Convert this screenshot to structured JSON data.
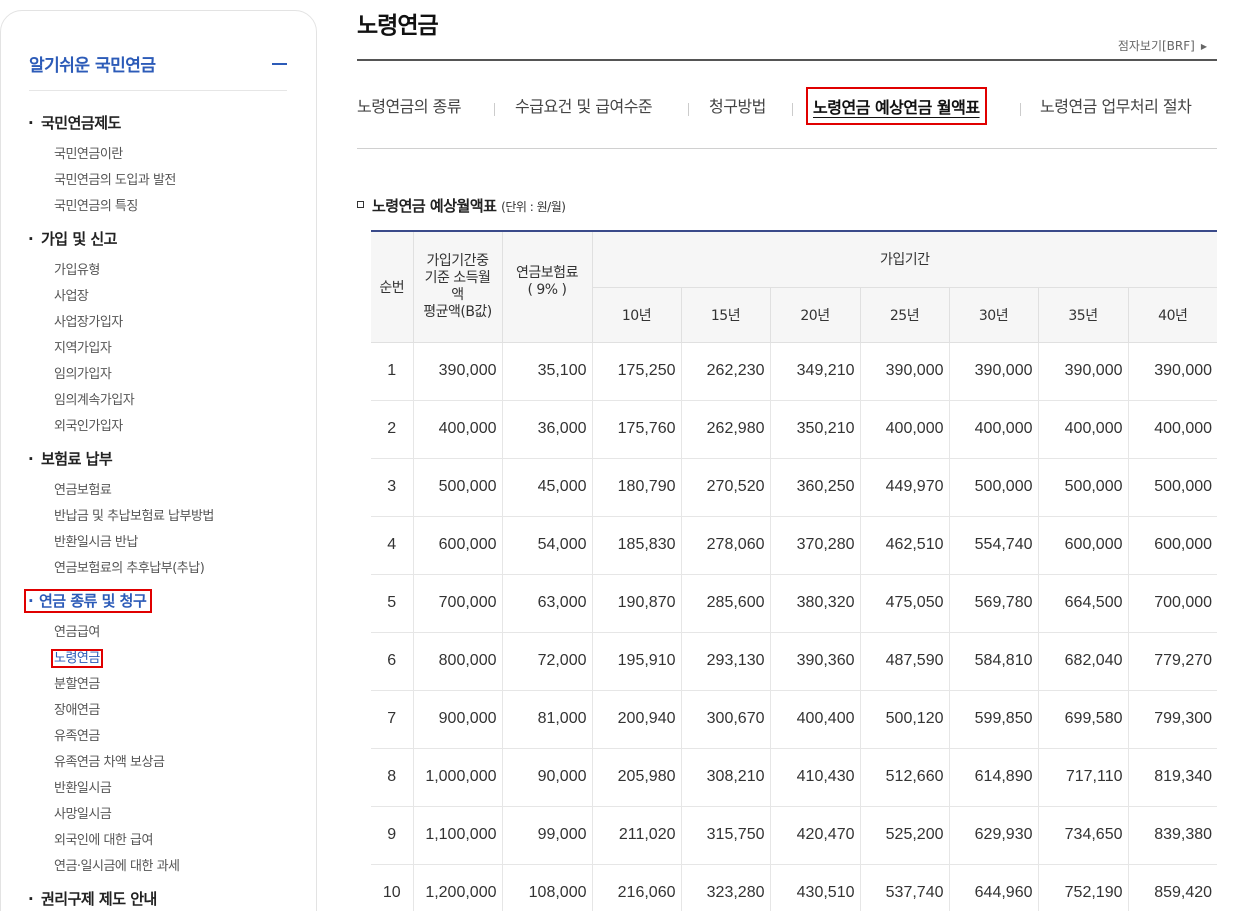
{
  "sidebar": {
    "title": "알기쉬운 국민연금",
    "sections": [
      {
        "label": "국민연금제도",
        "items": [
          "국민연금이란",
          "국민연금의 도입과 발전",
          "국민연금의 특징"
        ]
      },
      {
        "label": "가입 및 신고",
        "items": [
          "가입유형",
          "사업장",
          "사업장가입자",
          "지역가입자",
          "임의가입자",
          "임의계속가입자",
          "외국인가입자"
        ]
      },
      {
        "label": "보험료 납부",
        "items": [
          "연금보험료",
          "반납금 및 추납보험료 납부방법",
          "반환일시금 반납",
          "연금보험료의 추후납부(추납)"
        ]
      },
      {
        "label": "연금 종류 및 청구",
        "items": [
          "연금급여",
          "노령연금",
          "분할연금",
          "장애연금",
          "유족연금",
          "유족연금 차액 보상금",
          "반환일시금",
          "사망일시금",
          "외국인에 대한 급여",
          "연금·일시금에 대한 과세"
        ]
      },
      {
        "label": "권리구제 제도 안내",
        "items": []
      }
    ]
  },
  "main": {
    "title": "노령연금",
    "braille_link": "점자보기[BRF]",
    "tabs": [
      "노령연금의 종류",
      "수급요건 및 급여수준",
      "청구방법",
      "노령연금 예상연금 월액표",
      "노령연금 업무처리 절차"
    ],
    "table_title": "노령연금 예상월액표",
    "table_unit": "(단위 : 원/월)",
    "headers": {
      "no": "순번",
      "income_lines": [
        "가입기간중",
        "기준 소득월",
        "액",
        "평균액(B값)"
      ],
      "premium_lines": [
        "연금보험료",
        "( 9% )"
      ],
      "period": "가입기간",
      "years": [
        "10년",
        "15년",
        "20년",
        "25년",
        "30년",
        "35년",
        "40년"
      ]
    },
    "rows": [
      [
        "1",
        "390,000",
        "35,100",
        "175,250",
        "262,230",
        "349,210",
        "390,000",
        "390,000",
        "390,000",
        "390,000"
      ],
      [
        "2",
        "400,000",
        "36,000",
        "175,760",
        "262,980",
        "350,210",
        "400,000",
        "400,000",
        "400,000",
        "400,000"
      ],
      [
        "3",
        "500,000",
        "45,000",
        "180,790",
        "270,520",
        "360,250",
        "449,970",
        "500,000",
        "500,000",
        "500,000"
      ],
      [
        "4",
        "600,000",
        "54,000",
        "185,830",
        "278,060",
        "370,280",
        "462,510",
        "554,740",
        "600,000",
        "600,000"
      ],
      [
        "5",
        "700,000",
        "63,000",
        "190,870",
        "285,600",
        "380,320",
        "475,050",
        "569,780",
        "664,500",
        "700,000"
      ],
      [
        "6",
        "800,000",
        "72,000",
        "195,910",
        "293,130",
        "390,360",
        "487,590",
        "584,810",
        "682,040",
        "779,270"
      ],
      [
        "7",
        "900,000",
        "81,000",
        "200,940",
        "300,670",
        "400,400",
        "500,120",
        "599,850",
        "699,580",
        "799,300"
      ],
      [
        "8",
        "1,000,000",
        "90,000",
        "205,980",
        "308,210",
        "410,430",
        "512,660",
        "614,890",
        "717,110",
        "819,340"
      ],
      [
        "9",
        "1,100,000",
        "99,000",
        "211,020",
        "315,750",
        "420,470",
        "525,200",
        "629,930",
        "734,650",
        "839,380"
      ],
      [
        "10",
        "1,200,000",
        "108,000",
        "216,060",
        "323,280",
        "430,510",
        "537,740",
        "644,960",
        "752,190",
        "859,420"
      ]
    ]
  },
  "colors": {
    "accent": "#2c5bb8",
    "highlight": "#e00000",
    "table_top": "#3a4a8a"
  }
}
